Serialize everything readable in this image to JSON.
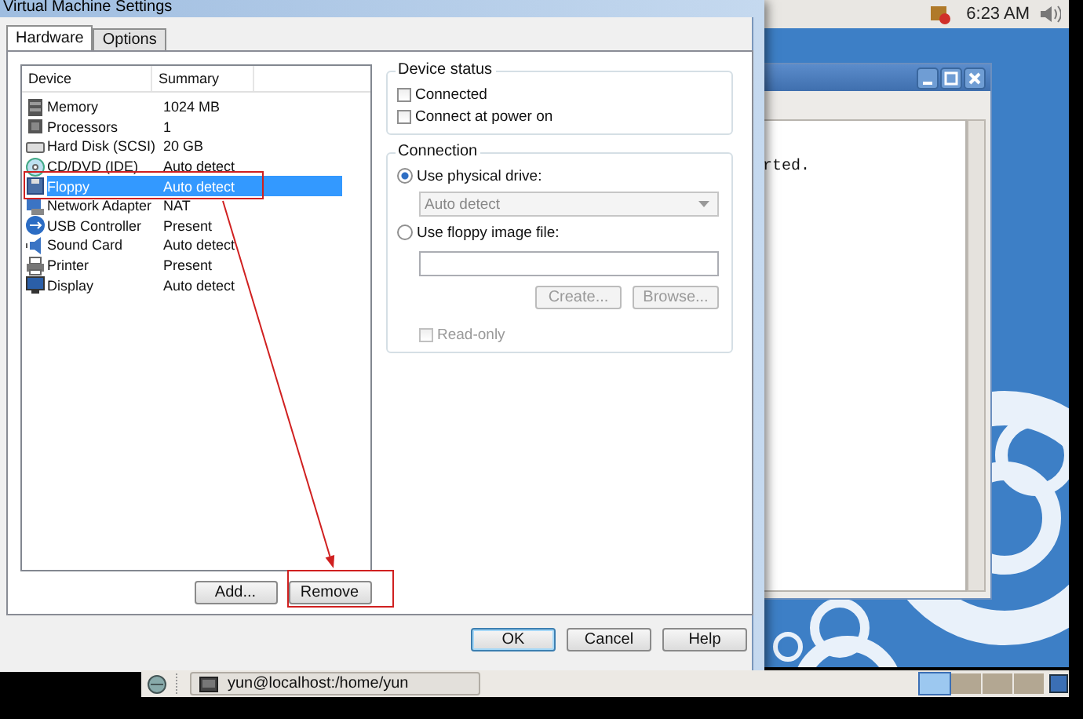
{
  "top_panel": {
    "clock": "6:23 AM"
  },
  "terminal": {
    "visible_text": "rted."
  },
  "dialog": {
    "title": "Virtual Machine Settings",
    "tabs": [
      {
        "label": "Hardware",
        "selected": true
      },
      {
        "label": "Options",
        "selected": false
      }
    ],
    "device_list": {
      "columns": [
        "Device",
        "Summary"
      ],
      "rows": [
        {
          "kind": "memory",
          "device": "Memory",
          "summary": "1024 MB",
          "selected": false,
          "highlighted": false
        },
        {
          "kind": "processor",
          "device": "Processors",
          "summary": "1",
          "selected": false,
          "highlighted": false
        },
        {
          "kind": "disk",
          "device": "Hard Disk (SCSI)",
          "summary": "20 GB",
          "selected": false,
          "highlighted": false
        },
        {
          "kind": "cdrom",
          "device": "CD/DVD (IDE)",
          "summary": "Auto detect",
          "selected": false,
          "highlighted": false
        },
        {
          "kind": "floppy",
          "device": "Floppy",
          "summary": "Auto detect",
          "selected": true,
          "highlighted": true
        },
        {
          "kind": "network",
          "device": "Network Adapter",
          "summary": "NAT",
          "selected": false,
          "highlighted": false
        },
        {
          "kind": "usb",
          "device": "USB Controller",
          "summary": "Present",
          "selected": false,
          "highlighted": false
        },
        {
          "kind": "sound",
          "device": "Sound Card",
          "summary": "Auto detect",
          "selected": false,
          "highlighted": false
        },
        {
          "kind": "printer",
          "device": "Printer",
          "summary": "Present",
          "selected": false,
          "highlighted": false
        },
        {
          "kind": "display",
          "device": "Display",
          "summary": "Auto detect",
          "selected": false,
          "highlighted": false
        }
      ]
    },
    "list_buttons": [
      {
        "label": "Add...",
        "highlighted": false
      },
      {
        "label": "Remove",
        "highlighted": true
      }
    ],
    "device_status": {
      "title": "Device status",
      "options": [
        {
          "label": "Connected",
          "checked": false
        },
        {
          "label": "Connect at power on",
          "checked": false
        }
      ]
    },
    "connection": {
      "title": "Connection",
      "physical": {
        "label": "Use physical drive:",
        "selected": true
      },
      "drive": {
        "value": "Auto detect",
        "disabled": true
      },
      "image": {
        "label": "Use floppy image file:",
        "selected": false
      },
      "image_buttons": [
        {
          "label": "Create...",
          "disabled": true
        },
        {
          "label": "Browse...",
          "disabled": true
        }
      ],
      "read_only": {
        "label": "Read-only",
        "checked": false,
        "disabled": true
      }
    },
    "buttons": [
      {
        "label": "OK",
        "default": true
      },
      {
        "label": "Cancel",
        "default": false
      },
      {
        "label": "Help",
        "default": false
      }
    ]
  },
  "taskbar": {
    "items": [
      {
        "label": "yun@localhost:/home/yun"
      }
    ],
    "workspaces": [
      {
        "selected": true
      },
      {
        "selected": false
      },
      {
        "selected": false
      },
      {
        "selected": false
      }
    ]
  }
}
